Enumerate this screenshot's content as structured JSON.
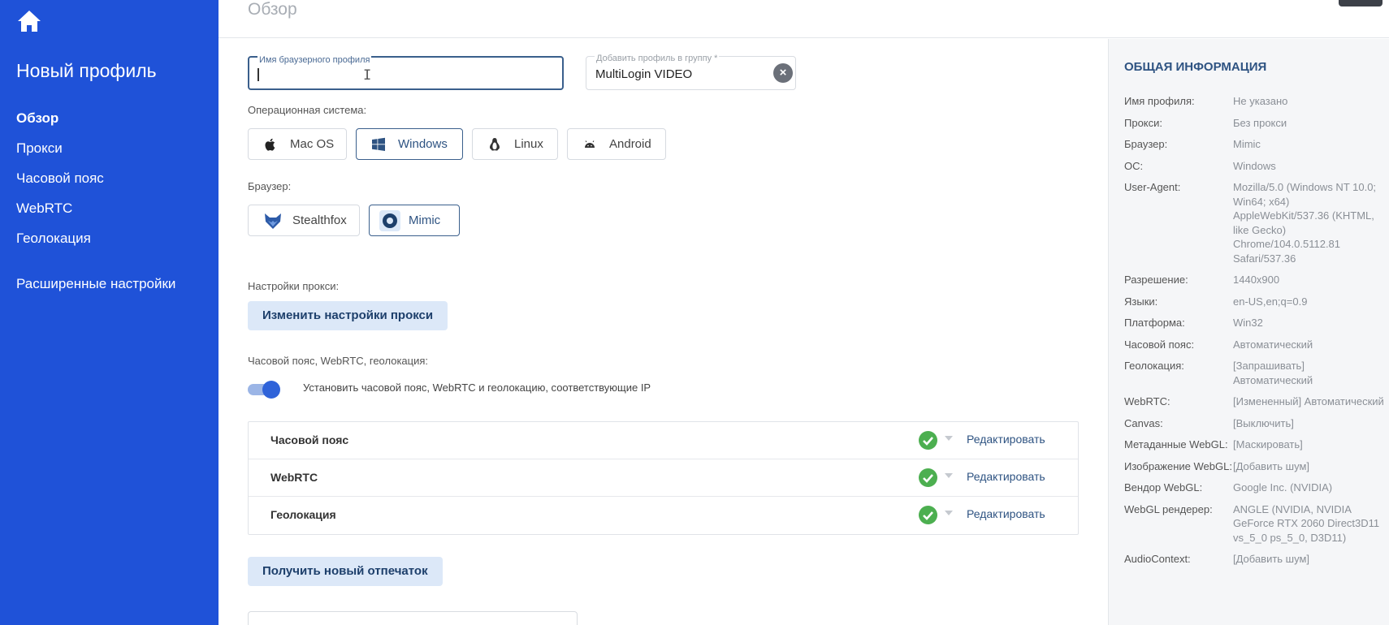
{
  "sidebar": {
    "title": "Новый профиль",
    "nav": [
      "Обзор",
      "Прокси",
      "Часовой пояс",
      "WebRTC",
      "Геолокация"
    ],
    "advanced": "Расширенные настройки"
  },
  "header": {
    "title": "Обзор"
  },
  "form": {
    "profile_name_label": "Имя браузерного профиля",
    "profile_name_value": "",
    "group_label": "Добавить профиль в группу *",
    "group_value": "MultiLogin VIDEO",
    "clear_icon": "×",
    "os_label": "Операционная система:",
    "os_options": [
      "Mac OS",
      "Windows",
      "Linux",
      "Android"
    ],
    "os_selected": "Windows",
    "browser_label": "Браузер:",
    "browser_options": [
      "Stealthfox",
      "Mimic"
    ],
    "browser_selected": "Mimic",
    "proxy_label": "Настройки прокси:",
    "proxy_button": "Изменить настройки прокси",
    "tz_label": "Часовой пояс, WebRTC, геолокация:",
    "tz_toggle_text": "Установить часовой пояс, WebRTC и геолокацию, соответствующие IP",
    "tz_toggle_on": true,
    "tz_rows": [
      {
        "label": "Часовой пояс",
        "edit": "Редактировать"
      },
      {
        "label": "WebRTC",
        "edit": "Редактировать"
      },
      {
        "label": "Геолокация",
        "edit": "Редактировать"
      }
    ],
    "fingerprint_button": "Получить новый отпечаток"
  },
  "info_panel": {
    "title": "ОБЩАЯ ИНФОРМАЦИЯ",
    "rows": [
      {
        "k": "Имя профиля:",
        "v": "Не указано"
      },
      {
        "k": "Прокси:",
        "v": "Без прокси"
      },
      {
        "k": "Браузер:",
        "v": "Mimic"
      },
      {
        "k": "ОС:",
        "v": "Windows"
      },
      {
        "k": "User-Agent:",
        "v": "Mozilla/5.0 (Windows NT 10.0; Win64; x64) AppleWebKit/537.36 (KHTML, like Gecko) Chrome/104.0.5112.81 Safari/537.36"
      },
      {
        "k": "Разрешение:",
        "v": "1440x900"
      },
      {
        "k": "Языки:",
        "v": "en-US,en;q=0.9"
      },
      {
        "k": "Платформа:",
        "v": "Win32"
      },
      {
        "k": "Часовой пояс:",
        "v": "Автоматический"
      },
      {
        "k": "Геолокация:",
        "v": "[Запрашивать] Автоматический"
      },
      {
        "k": "WebRTC:",
        "v": "[Измененный] Автоматический"
      },
      {
        "k": "Canvas:",
        "v": "[Выключить]"
      },
      {
        "k": "Метаданные WebGL:",
        "v": "[Маскировать]"
      },
      {
        "k": "Изображение WebGL:",
        "v": "[Добавить шум]"
      },
      {
        "k": "Вендор WebGL:",
        "v": "Google Inc. (NVIDIA)"
      },
      {
        "k": "WebGL рендерер:",
        "v": "ANGLE (NVIDIA, NVIDIA GeForce RTX 2060 Direct3D11 vs_5_0 ps_5_0, D3D11)"
      },
      {
        "k": "AudioContext:",
        "v": "[Добавить шум]"
      }
    ]
  }
}
